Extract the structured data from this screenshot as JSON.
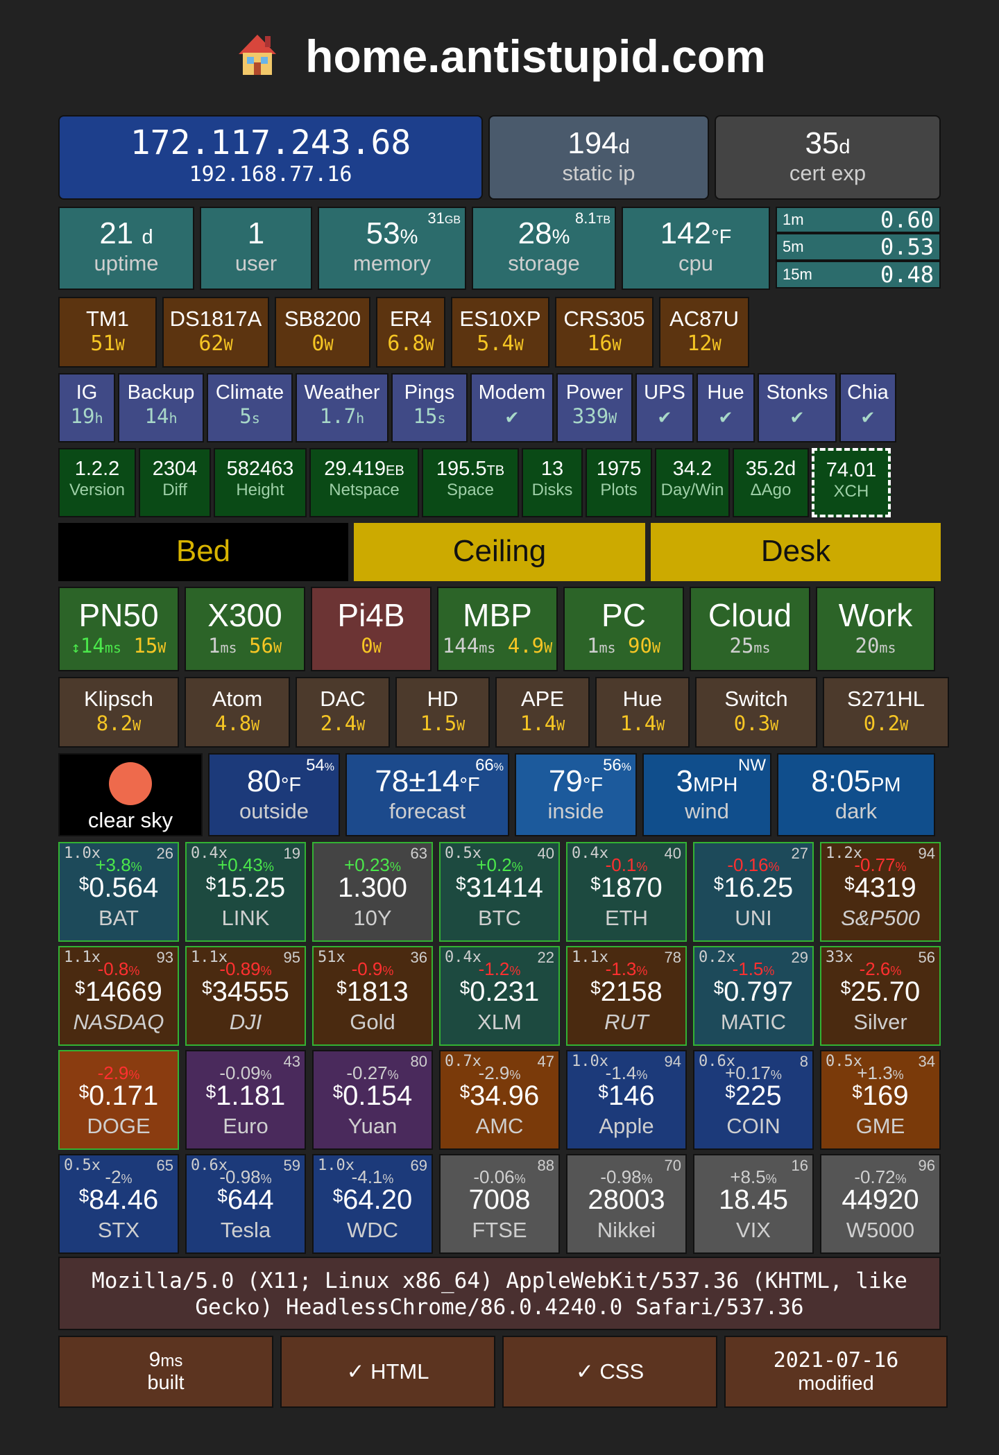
{
  "header": {
    "title": "home.antistupid.com",
    "icon": "house-icon"
  },
  "network": {
    "public_ip": "172.117.243.68",
    "local_ip": "192.168.77.16",
    "static_days": "194",
    "static_unit": "d",
    "static_label": "static ip",
    "cert_days": "35",
    "cert_unit": "d",
    "cert_label": "cert exp"
  },
  "system": {
    "uptime": "21",
    "uptime_unit": "d",
    "uptime_label": "uptime",
    "users": "1",
    "users_label": "user",
    "memory": "53",
    "memory_unit": "%",
    "memory_label": "memory",
    "memory_total": "31",
    "memory_total_unit": "GB",
    "storage": "28",
    "storage_unit": "%",
    "storage_label": "storage",
    "storage_total": "8.1",
    "storage_total_unit": "TB",
    "cpu": "142",
    "cpu_unit": "°F",
    "cpu_label": "cpu",
    "load": [
      {
        "label": "1m",
        "value": "0.60"
      },
      {
        "label": "5m",
        "value": "0.53"
      },
      {
        "label": "15m",
        "value": "0.48"
      }
    ]
  },
  "devices": [
    {
      "name": "TM1",
      "value": "51",
      "unit": "W"
    },
    {
      "name": "DS1817A",
      "value": "62",
      "unit": "W"
    },
    {
      "name": "SB8200",
      "value": "0",
      "unit": "W"
    },
    {
      "name": "ER4",
      "value": "6.8",
      "unit": "W"
    },
    {
      "name": "ES10XP",
      "value": "5.4",
      "unit": "W"
    },
    {
      "name": "CRS305",
      "value": "16",
      "unit": "W"
    },
    {
      "name": "AC87U",
      "value": "12",
      "unit": "W"
    }
  ],
  "services": [
    {
      "name": "IG",
      "value": "19",
      "unit": "h"
    },
    {
      "name": "Backup",
      "value": "14",
      "unit": "h"
    },
    {
      "name": "Climate",
      "value": "5",
      "unit": "s"
    },
    {
      "name": "Weather",
      "value": "1.7",
      "unit": "h"
    },
    {
      "name": "Pings",
      "value": "15",
      "unit": "s"
    },
    {
      "name": "Modem",
      "value": "✔",
      "unit": ""
    },
    {
      "name": "Power",
      "value": "339",
      "unit": "W"
    },
    {
      "name": "UPS",
      "value": "✔",
      "unit": ""
    },
    {
      "name": "Hue",
      "value": "✔",
      "unit": ""
    },
    {
      "name": "Stonks",
      "value": "✔",
      "unit": ""
    },
    {
      "name": "Chia",
      "value": "✔",
      "unit": ""
    }
  ],
  "chia": [
    {
      "value": "1.2.2",
      "unit": "",
      "label": "Version"
    },
    {
      "value": "2304",
      "unit": "",
      "label": "Diff"
    },
    {
      "value": "582463",
      "unit": "",
      "label": "Height"
    },
    {
      "value": "29.419",
      "unit": "EB",
      "label": "Netspace"
    },
    {
      "value": "195.5",
      "unit": "TB",
      "label": "Space"
    },
    {
      "value": "13",
      "unit": "",
      "label": "Disks"
    },
    {
      "value": "1975",
      "unit": "",
      "label": "Plots"
    },
    {
      "value": "34.2",
      "unit": "",
      "label": "Day/Win"
    },
    {
      "value": "35.2d",
      "unit": "",
      "label": "ΔAgo"
    },
    {
      "value": "74.01",
      "unit": "",
      "label": "XCH"
    }
  ],
  "lights": [
    {
      "name": "Bed"
    },
    {
      "name": "Ceiling"
    },
    {
      "name": "Desk"
    }
  ],
  "hosts": [
    {
      "name": "PN50",
      "ping": "14",
      "ping_unit": "ms",
      "power": "15",
      "power_unit": "W",
      "arrow": "↕"
    },
    {
      "name": "X300",
      "ping": "1",
      "ping_unit": "ms",
      "power": "56",
      "power_unit": "W"
    },
    {
      "name": "Pi4B",
      "ping": "",
      "ping_unit": "",
      "power": "0",
      "power_unit": "W"
    },
    {
      "name": "MBP",
      "ping": "144",
      "ping_unit": "ms",
      "power": "4.9",
      "power_unit": "W"
    },
    {
      "name": "PC",
      "ping": "1",
      "ping_unit": "ms",
      "power": "90",
      "power_unit": "W"
    },
    {
      "name": "Cloud",
      "ping": "25",
      "ping_unit": "ms",
      "power": "",
      "power_unit": ""
    },
    {
      "name": "Work",
      "ping": "20",
      "ping_unit": "ms",
      "power": "",
      "power_unit": ""
    }
  ],
  "appliances": [
    {
      "name": "Klipsch",
      "value": "8.2",
      "unit": "W"
    },
    {
      "name": "Atom",
      "value": "4.8",
      "unit": "W"
    },
    {
      "name": "DAC",
      "value": "2.4",
      "unit": "W"
    },
    {
      "name": "HD",
      "value": "1.5",
      "unit": "W"
    },
    {
      "name": "APE",
      "value": "1.4",
      "unit": "W"
    },
    {
      "name": "Hue",
      "value": "1.4",
      "unit": "W"
    },
    {
      "name": "Switch",
      "value": "0.3",
      "unit": "W"
    },
    {
      "name": "S271HL",
      "value": "0.2",
      "unit": "W"
    }
  ],
  "weather": {
    "sky": "clear sky",
    "sun_color": "#ee6a4c",
    "outside": "80",
    "outside_unit": "°F",
    "outside_label": "outside",
    "outside_hum": "54",
    "hum_unit": "%",
    "forecast": "78±14",
    "forecast_unit": "°F",
    "forecast_label": "forecast",
    "forecast_hum": "66",
    "inside": "79",
    "inside_unit": "°F",
    "inside_label": "inside",
    "inside_hum": "56",
    "wind": "3",
    "wind_unit": "MPH",
    "wind_label": "wind",
    "wind_dir": "NW",
    "time": "8:05",
    "time_unit": "PM",
    "time_label": "dark"
  },
  "tickers": [
    [
      {
        "lev": "1.0x",
        "rank": "26",
        "chg": "+3.8",
        "price": "0.564",
        "cur": "$",
        "name": "BAT",
        "bg": "#1d4a5a",
        "dir": "up",
        "italic": false,
        "gb": true
      },
      {
        "lev": "0.4x",
        "rank": "19",
        "chg": "+0.43",
        "price": "15.25",
        "cur": "$",
        "name": "LINK",
        "bg": "#1d4a40",
        "dir": "up",
        "italic": false,
        "gb": true
      },
      {
        "lev": "",
        "rank": "63",
        "chg": "+0.23",
        "price": "1.300",
        "cur": "",
        "name": "10Y",
        "bg": "#444",
        "dir": "up",
        "italic": false,
        "gb": true
      },
      {
        "lev": "0.5x",
        "rank": "40",
        "chg": "+0.2",
        "price": "31414",
        "cur": "$",
        "name": "BTC",
        "bg": "#1d4a40",
        "dir": "up",
        "italic": false,
        "gb": true
      },
      {
        "lev": "0.4x",
        "rank": "40",
        "chg": "-0.1",
        "price": "1870",
        "cur": "$",
        "name": "ETH",
        "bg": "#1d4a40",
        "dir": "down",
        "italic": false,
        "gb": true
      },
      {
        "lev": "",
        "rank": "27",
        "chg": "-0.16",
        "price": "16.25",
        "cur": "$",
        "name": "UNI",
        "bg": "#1d4a5a",
        "dir": "down",
        "italic": false,
        "gb": true
      },
      {
        "lev": "1.2x",
        "rank": "94",
        "chg": "-0.77",
        "price": "4319",
        "cur": "$",
        "name": "S&P500",
        "bg": "#4a2a10",
        "dir": "down",
        "italic": true,
        "gb": true
      }
    ],
    [
      {
        "lev": "1.1x",
        "rank": "93",
        "chg": "-0.8",
        "price": "14669",
        "cur": "$",
        "name": "NASDAQ",
        "bg": "#4a2a10",
        "dir": "down",
        "italic": true,
        "gb": true
      },
      {
        "lev": "1.1x",
        "rank": "95",
        "chg": "-0.89",
        "price": "34555",
        "cur": "$",
        "name": "DJI",
        "bg": "#4a2a10",
        "dir": "down",
        "italic": true,
        "gb": true
      },
      {
        "lev": "51x",
        "rank": "36",
        "chg": "-0.9",
        "price": "1813",
        "cur": "$",
        "name": "Gold",
        "bg": "#4a2a10",
        "dir": "down",
        "italic": false,
        "gb": true
      },
      {
        "lev": "0.4x",
        "rank": "22",
        "chg": "-1.2",
        "price": "0.231",
        "cur": "$",
        "name": "XLM",
        "bg": "#1d4a40",
        "dir": "down",
        "italic": false,
        "gb": true
      },
      {
        "lev": "1.1x",
        "rank": "78",
        "chg": "-1.3",
        "price": "2158",
        "cur": "$",
        "name": "RUT",
        "bg": "#4a2a10",
        "dir": "down",
        "italic": true,
        "gb": true
      },
      {
        "lev": "0.2x",
        "rank": "29",
        "chg": "-1.5",
        "price": "0.797",
        "cur": "$",
        "name": "MATIC",
        "bg": "#1d4a5a",
        "dir": "down",
        "italic": false,
        "gb": true
      },
      {
        "lev": "33x",
        "rank": "56",
        "chg": "-2.6",
        "price": "25.70",
        "cur": "$",
        "name": "Silver",
        "bg": "#4a2a10",
        "dir": "down",
        "italic": false,
        "gb": true
      }
    ],
    [
      {
        "lev": "",
        "rank": "",
        "chg": "-2.9",
        "price": "0.171",
        "cur": "$",
        "name": "DOGE",
        "bg": "#8a3c10",
        "dir": "down",
        "italic": false,
        "gb": true
      },
      {
        "lev": "",
        "rank": "43",
        "chg": "-0.09",
        "price": "1.181",
        "cur": "$",
        "name": "Euro",
        "bg": "#4a2a5c",
        "dir": "flat",
        "italic": false,
        "gb": false
      },
      {
        "lev": "",
        "rank": "80",
        "chg": "-0.27",
        "price": "0.154",
        "cur": "$",
        "name": "Yuan",
        "bg": "#4a2a5c",
        "dir": "flat",
        "italic": false,
        "gb": false
      },
      {
        "lev": "0.7x",
        "rank": "47",
        "chg": "-2.9",
        "price": "34.96",
        "cur": "$",
        "name": "AMC",
        "bg": "#7a3a0a",
        "dir": "flat",
        "italic": false,
        "gb": false
      },
      {
        "lev": "1.0x",
        "rank": "94",
        "chg": "-1.4",
        "price": "146",
        "cur": "$",
        "name": "Apple",
        "bg": "#1c3a7a",
        "dir": "flat",
        "italic": false,
        "gb": false
      },
      {
        "lev": "0.6x",
        "rank": "8",
        "chg": "+0.17",
        "price": "225",
        "cur": "$",
        "name": "COIN",
        "bg": "#1c3a7a",
        "dir": "flat",
        "italic": false,
        "gb": false
      },
      {
        "lev": "0.5x",
        "rank": "34",
        "chg": "+1.3",
        "price": "169",
        "cur": "$",
        "name": "GME",
        "bg": "#7a3a0a",
        "dir": "flat",
        "italic": false,
        "gb": false
      }
    ],
    [
      {
        "lev": "0.5x",
        "rank": "65",
        "chg": "-2",
        "price": "84.46",
        "cur": "$",
        "name": "STX",
        "bg": "#1c3a7a",
        "dir": "flat",
        "italic": false,
        "gb": false
      },
      {
        "lev": "0.6x",
        "rank": "59",
        "chg": "-0.98",
        "price": "644",
        "cur": "$",
        "name": "Tesla",
        "bg": "#1c3a7a",
        "dir": "flat",
        "italic": false,
        "gb": false
      },
      {
        "lev": "1.0x",
        "rank": "69",
        "chg": "-4.1",
        "price": "64.20",
        "cur": "$",
        "name": "WDC",
        "bg": "#1c3a7a",
        "dir": "flat",
        "italic": false,
        "gb": false
      },
      {
        "lev": "",
        "rank": "88",
        "chg": "-0.06",
        "price": "7008",
        "cur": "",
        "name": "FTSE",
        "bg": "#555",
        "dir": "flat",
        "italic": false,
        "gb": false
      },
      {
        "lev": "",
        "rank": "70",
        "chg": "-0.98",
        "price": "28003",
        "cur": "",
        "name": "Nikkei",
        "bg": "#555",
        "dir": "flat",
        "italic": false,
        "gb": false
      },
      {
        "lev": "",
        "rank": "16",
        "chg": "+8.5",
        "price": "18.45",
        "cur": "",
        "name": "VIX",
        "bg": "#555",
        "dir": "flat",
        "italic": false,
        "gb": false
      },
      {
        "lev": "",
        "rank": "96",
        "chg": "-0.72",
        "price": "44920",
        "cur": "",
        "name": "W5000",
        "bg": "#555",
        "dir": "flat",
        "italic": false,
        "gb": false
      }
    ]
  ],
  "pct": "%",
  "user_agent": "Mozilla/5.0 (X11; Linux x86_64) AppleWebKit/537.36 (KHTML, like Gecko) HeadlessChrome/86.0.4240.0 Safari/537.36",
  "footer": {
    "built": "9",
    "built_unit": "ms",
    "built_label": "built",
    "html": "✓ HTML",
    "css": "✓ CSS",
    "modified": "2021-07-16",
    "modified_label": "modified"
  }
}
